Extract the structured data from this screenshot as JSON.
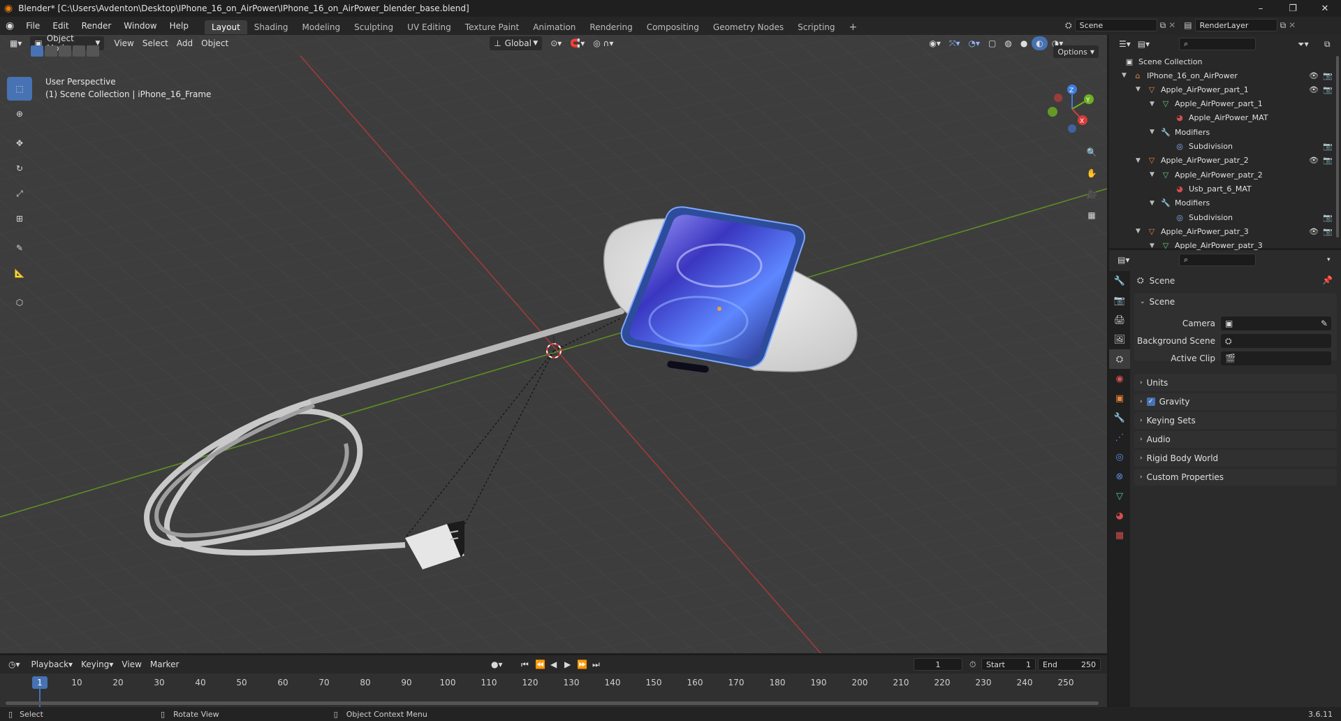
{
  "window": {
    "title": "Blender* [C:\\Users\\Avdenton\\Desktop\\IPhone_16_on_AirPower\\IPhone_16_on_AirPower_blender_base.blend]",
    "minimize": "–",
    "maximize": "❐",
    "close": "✕"
  },
  "menubar": {
    "menus": [
      "File",
      "Edit",
      "Render",
      "Window",
      "Help"
    ],
    "workspaces": [
      "Layout",
      "Shading",
      "Modeling",
      "Sculpting",
      "UV Editing",
      "Texture Paint",
      "Animation",
      "Rendering",
      "Compositing",
      "Geometry Nodes",
      "Scripting"
    ],
    "active_workspace": "Layout",
    "add_workspace": "+",
    "scene_name": "Scene",
    "view_layer": "RenderLayer"
  },
  "viewport": {
    "mode": "Object Mode",
    "menus": [
      "View",
      "Select",
      "Add",
      "Object"
    ],
    "transform_orientation": "Global",
    "options_label": "Options",
    "perspective_label": "User Perspective",
    "collection_label": "(1) Scene Collection | iPhone_16_Frame",
    "axes": {
      "z": "Z",
      "y": "Y",
      "x": "X"
    }
  },
  "outliner": {
    "root": "Scene Collection",
    "rows": [
      {
        "label": "IPhone_16_on_AirPower",
        "icon": "collection-icon",
        "level": 0,
        "eye": true,
        "cam": true
      },
      {
        "label": "Apple_AirPower_part_1",
        "icon": "object-icon",
        "level": 1,
        "eye": true,
        "cam": true
      },
      {
        "label": "Apple_AirPower_part_1",
        "icon": "mesh-icon",
        "level": 2,
        "eye": false,
        "cam": false
      },
      {
        "label": "Apple_AirPower_MAT",
        "icon": "material-icon",
        "level": 3,
        "eye": false,
        "cam": false
      },
      {
        "label": "Modifiers",
        "icon": "wrench-icon",
        "level": 2,
        "eye": false,
        "cam": false
      },
      {
        "label": "Subdivision",
        "icon": "modifier-icon",
        "level": 3,
        "eye": false,
        "cam": true
      },
      {
        "label": "Apple_AirPower_patr_2",
        "icon": "object-icon",
        "level": 1,
        "eye": true,
        "cam": true
      },
      {
        "label": "Apple_AirPower_patr_2",
        "icon": "mesh-icon",
        "level": 2,
        "eye": false,
        "cam": false
      },
      {
        "label": "Usb_part_6_MAT",
        "icon": "material-icon",
        "level": 3,
        "eye": false,
        "cam": false
      },
      {
        "label": "Modifiers",
        "icon": "wrench-icon",
        "level": 2,
        "eye": false,
        "cam": false
      },
      {
        "label": "Subdivision",
        "icon": "modifier-icon",
        "level": 3,
        "eye": false,
        "cam": true
      },
      {
        "label": "Apple_AirPower_patr_3",
        "icon": "object-icon",
        "level": 1,
        "eye": true,
        "cam": true
      },
      {
        "label": "Apple_AirPower_patr_3",
        "icon": "mesh-icon",
        "level": 2,
        "eye": false,
        "cam": false
      }
    ]
  },
  "properties": {
    "context": "Scene",
    "section": "Scene",
    "camera_label": "Camera",
    "background_label": "Background Scene",
    "clip_label": "Active Clip",
    "panels": [
      "Units",
      "Gravity",
      "Keying Sets",
      "Audio",
      "Rigid Body World",
      "Custom Properties"
    ],
    "gravity_checked": true
  },
  "timeline": {
    "menus": [
      "Playback",
      "Keying",
      "View",
      "Marker"
    ],
    "current_frame": "1",
    "start_label": "Start",
    "start": "1",
    "end_label": "End",
    "end": "250",
    "ticks": [
      "10",
      "20",
      "30",
      "40",
      "50",
      "60",
      "70",
      "80",
      "90",
      "100",
      "110",
      "120",
      "130",
      "140",
      "150",
      "160",
      "170",
      "180",
      "190",
      "200",
      "210",
      "220",
      "230",
      "240",
      "250"
    ],
    "playhead": "1"
  },
  "statusbar": {
    "select": "Select",
    "rotate": "Rotate View",
    "context": "Object Context Menu",
    "version": "3.6.11"
  },
  "colors": {
    "accent": "#4772b3",
    "x_axis": "#c33b3b",
    "y_axis": "#6f9a25",
    "object_orange": "#e8843c",
    "mesh_green": "#5fcf83",
    "material_red": "#d54d4d"
  }
}
